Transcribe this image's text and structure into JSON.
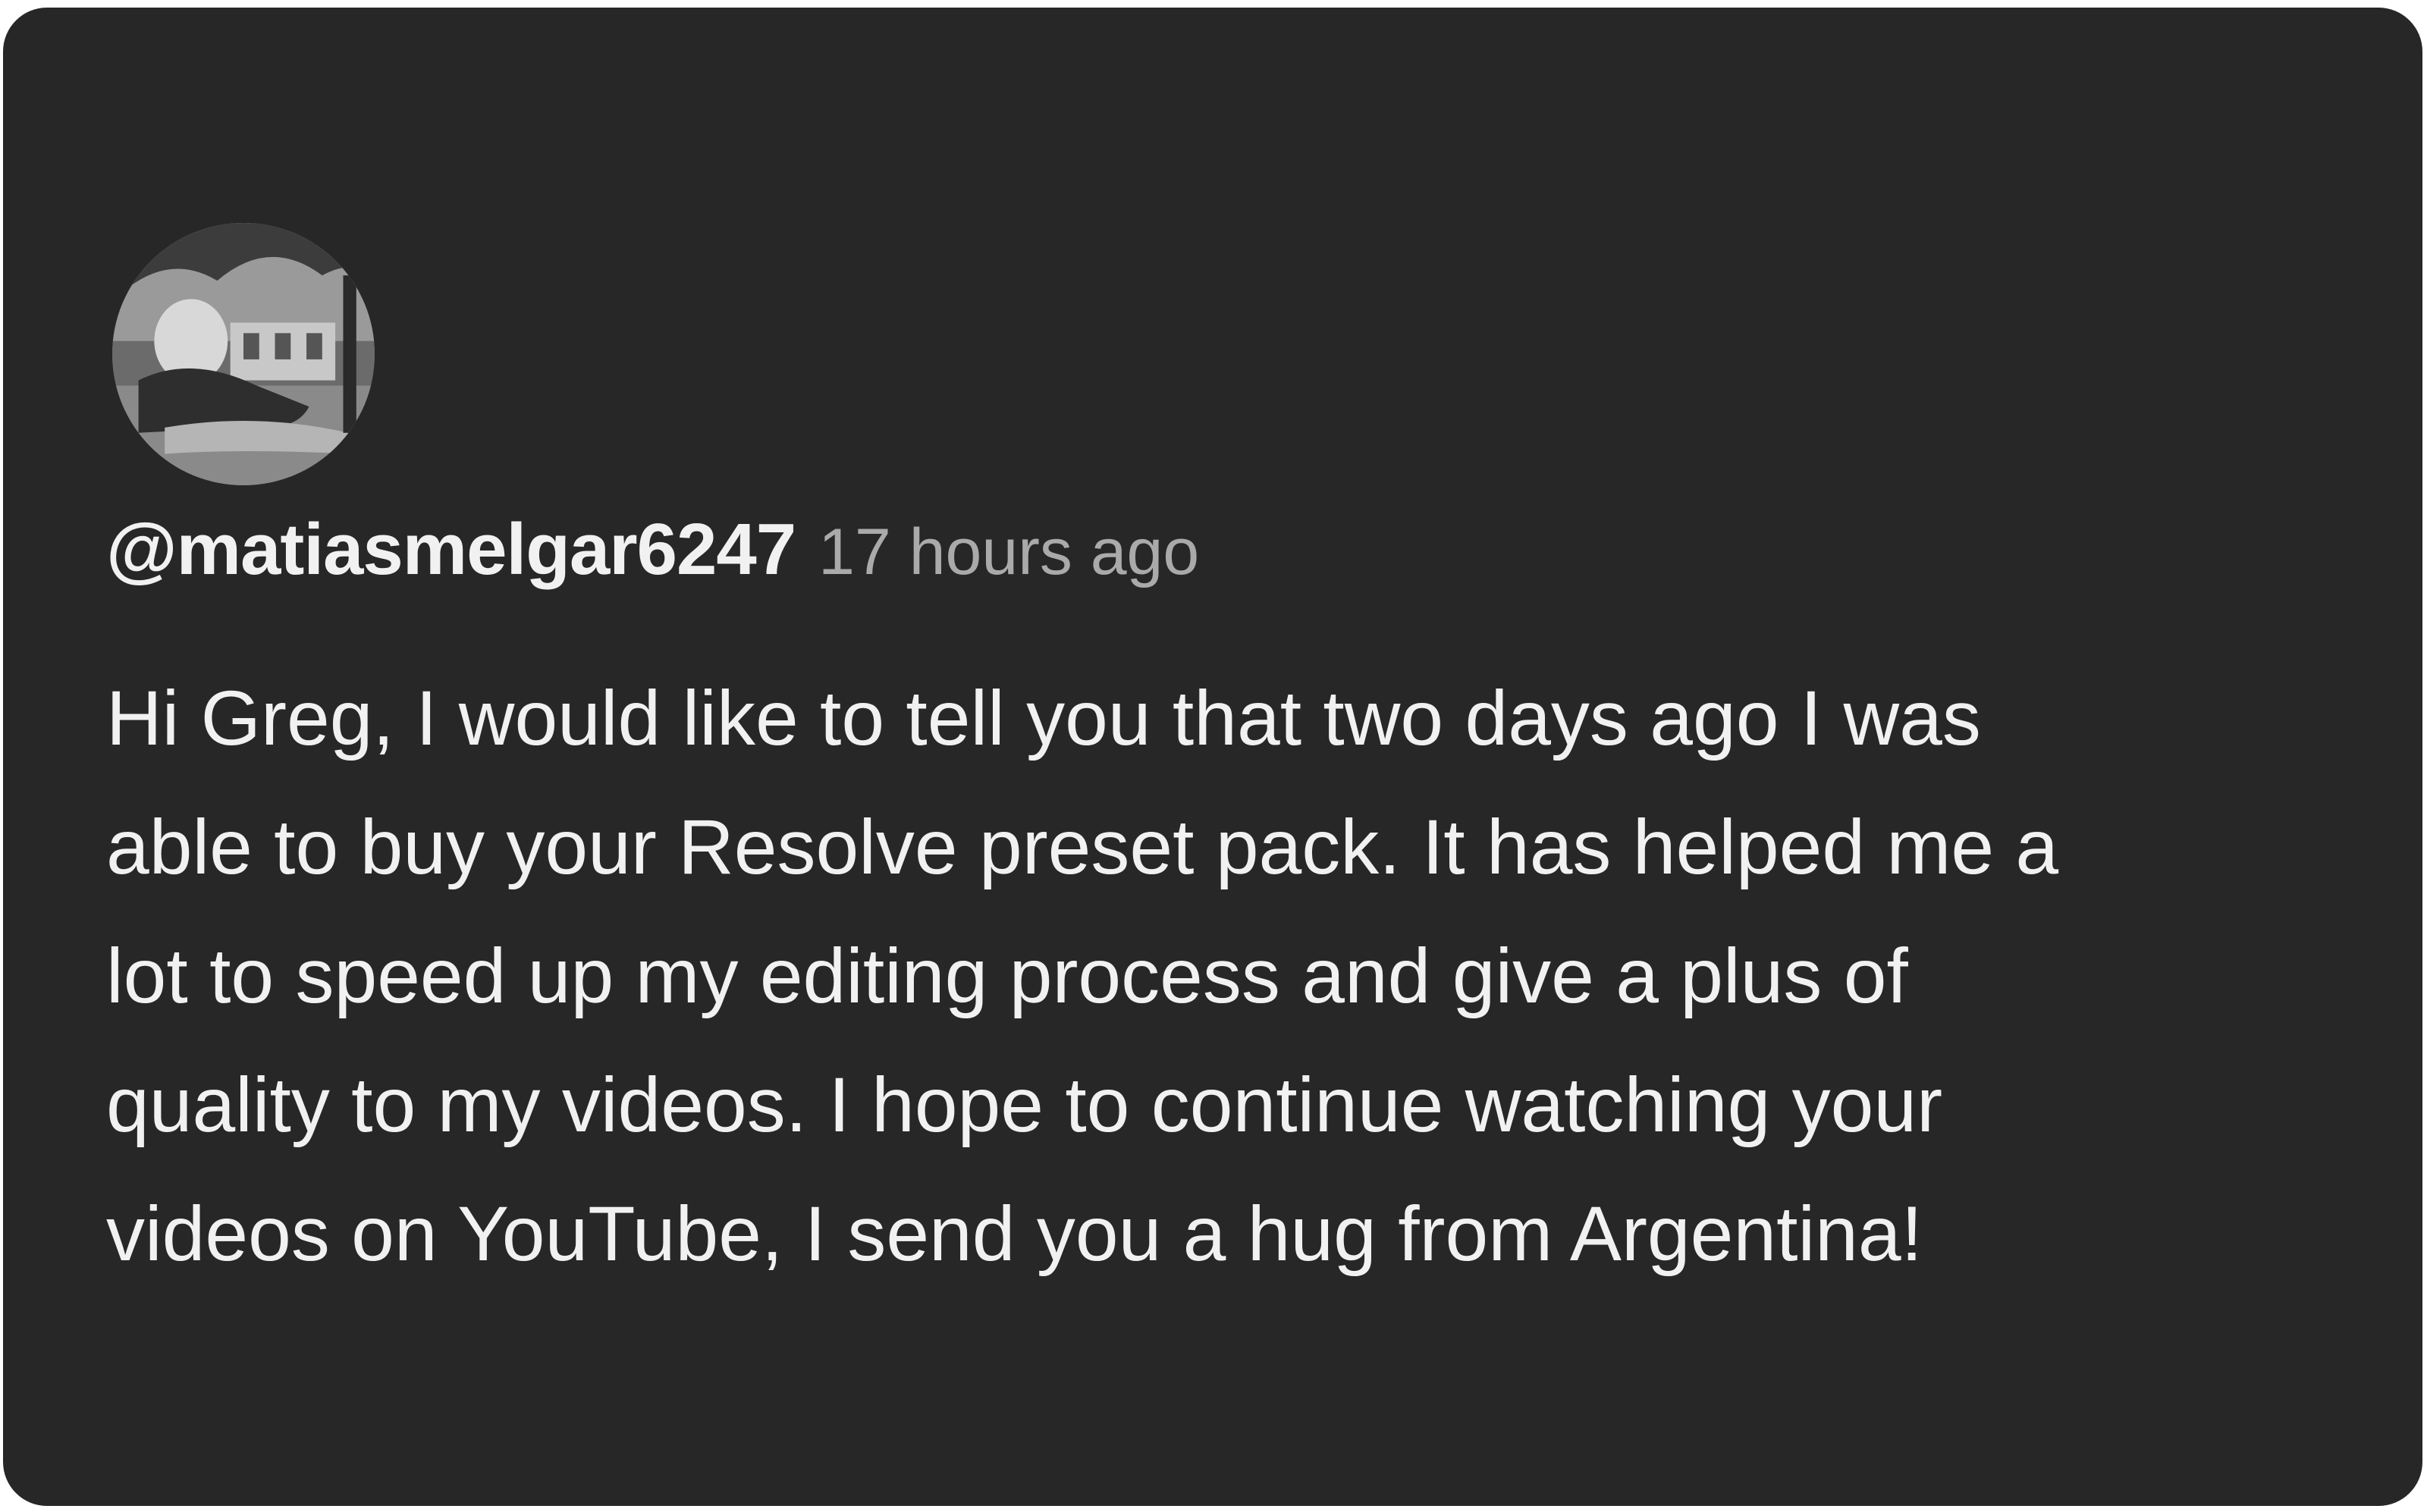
{
  "comment": {
    "author": "@matiasmelgar6247",
    "timestamp": "17 hours ago",
    "text_lines": [
      "Hi Greg, I would like to tell you that two days ago I was",
      "able to buy your Resolve preset pack. It has helped me a",
      "lot to speed up my editing process and give a plus of",
      "quality to my videos. I hope to continue watching your",
      "videos on YouTube, I send you a hug from Argentina!"
    ],
    "avatar": "user-avatar-photo"
  },
  "colors": {
    "background": "#272727",
    "text": "#f1f1f1",
    "muted": "#aaaaaa"
  }
}
